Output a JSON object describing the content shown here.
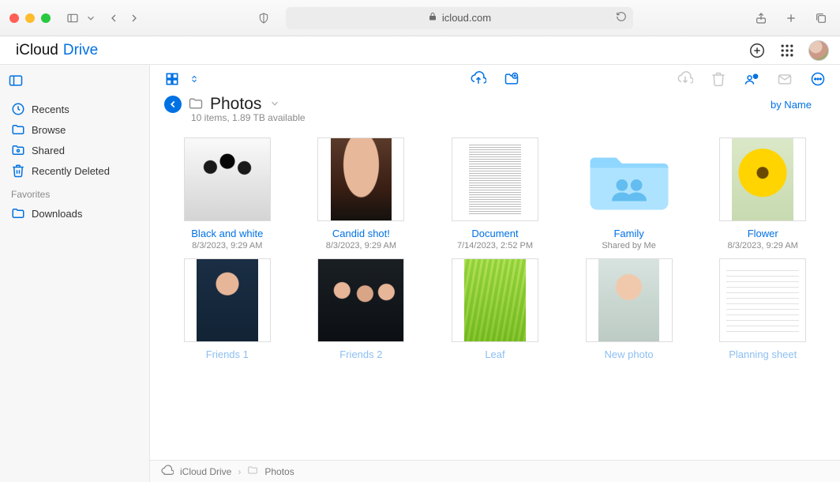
{
  "browser": {
    "url": "icloud.com"
  },
  "brand": {
    "icloud": "iCloud",
    "drive": "Drive"
  },
  "sidebar": {
    "items": [
      {
        "label": "Recents"
      },
      {
        "label": "Browse"
      },
      {
        "label": "Shared"
      },
      {
        "label": "Recently Deleted"
      }
    ],
    "favorites_header": "Favorites",
    "favorites": [
      {
        "label": "Downloads"
      }
    ]
  },
  "page": {
    "title": "Photos",
    "subtitle": "10 items, 1.89 TB available",
    "sort": "by Name"
  },
  "files": [
    {
      "name": "Black and white",
      "meta": "8/3/2023, 9:29 AM"
    },
    {
      "name": "Candid shot!",
      "meta": "8/3/2023, 9:29 AM"
    },
    {
      "name": "Document",
      "meta": "7/14/2023, 2:52 PM"
    },
    {
      "name": "Family",
      "meta": "Shared by Me"
    },
    {
      "name": "Flower",
      "meta": "8/3/2023, 9:29 AM"
    },
    {
      "name": "Friends 1",
      "meta": ""
    },
    {
      "name": "Friends 2",
      "meta": ""
    },
    {
      "name": "Leaf",
      "meta": ""
    },
    {
      "name": "New photo",
      "meta": ""
    },
    {
      "name": "Planning sheet",
      "meta": ""
    }
  ],
  "breadcrumb": {
    "root": "iCloud Drive",
    "current": "Photos"
  }
}
